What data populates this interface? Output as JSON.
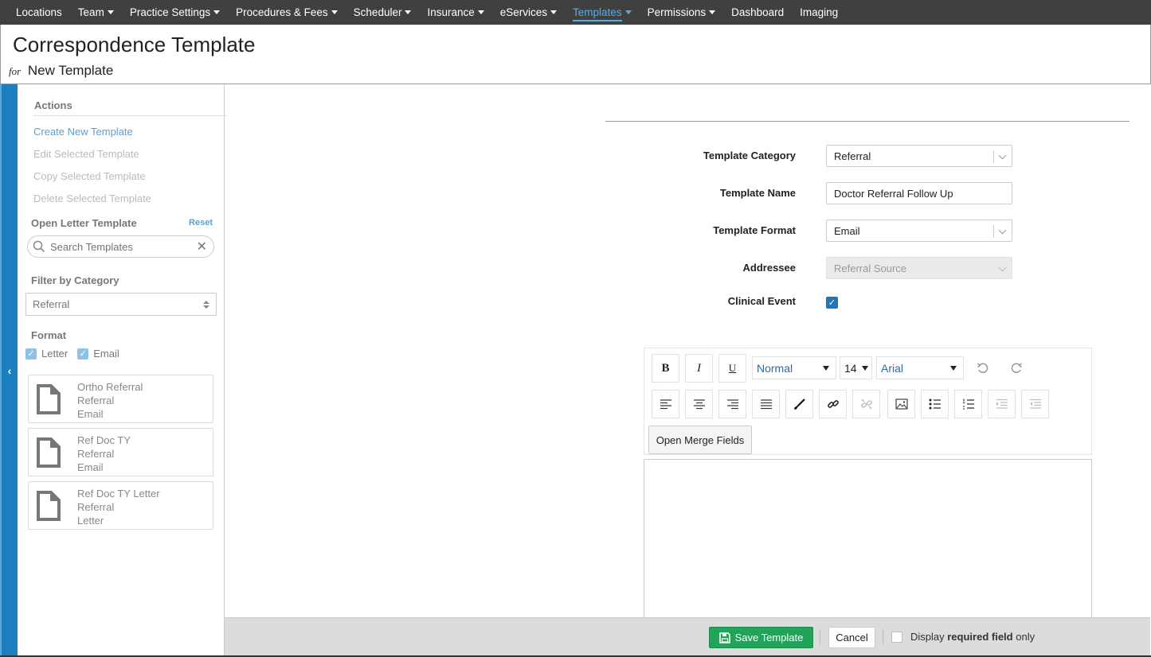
{
  "nav": {
    "items": [
      {
        "label": "Locations",
        "caret": false,
        "active": false
      },
      {
        "label": "Team",
        "caret": true,
        "active": false
      },
      {
        "label": "Practice Settings",
        "caret": true,
        "active": false
      },
      {
        "label": "Procedures & Fees",
        "caret": true,
        "active": false
      },
      {
        "label": "Scheduler",
        "caret": true,
        "active": false
      },
      {
        "label": "Insurance",
        "caret": true,
        "active": false
      },
      {
        "label": "eServices",
        "caret": true,
        "active": false
      },
      {
        "label": "Templates",
        "caret": true,
        "active": true
      },
      {
        "label": "Permissions",
        "caret": true,
        "active": false
      },
      {
        "label": "Dashboard",
        "caret": false,
        "active": false
      },
      {
        "label": "Imaging",
        "caret": false,
        "active": false
      }
    ]
  },
  "header": {
    "title": "Correspondence Template",
    "for_label": "for",
    "subtitle": "New Template"
  },
  "sidebar": {
    "actions_title": "Actions",
    "actions": [
      {
        "label": "Create New Template",
        "enabled": true
      },
      {
        "label": "Edit Selected Template",
        "enabled": false
      },
      {
        "label": "Copy Selected Template",
        "enabled": false
      },
      {
        "label": "Delete Selected Template",
        "enabled": false
      }
    ],
    "open_letter_title": "Open Letter Template",
    "reset_label": "Reset",
    "search_placeholder": "Search Templates",
    "filter_title": "Filter by Category",
    "filter_value": "Referral",
    "format_title": "Format",
    "format_letter": "Letter",
    "format_email": "Email",
    "templates": [
      {
        "name": "Ortho Referral",
        "category": "Referral",
        "format": "Email"
      },
      {
        "name": "Ref Doc TY",
        "category": "Referral",
        "format": "Email"
      },
      {
        "name": "Ref Doc TY Letter",
        "category": "Referral",
        "format": "Letter"
      }
    ]
  },
  "form": {
    "category_label": "Template Category",
    "category_value": "Referral",
    "name_label": "Template Name",
    "name_value": "Doctor Referral Follow Up",
    "format_label": "Template Format",
    "format_value": "Email",
    "addressee_label": "Addressee",
    "addressee_value": "Referral Source",
    "clinical_label": "Clinical Event",
    "clinical_checked": true
  },
  "editor": {
    "style_value": "Normal",
    "size_value": "14",
    "font_value": "Arial",
    "merge_label": "Open Merge Fields",
    "bold_label": "B",
    "italic_label": "I",
    "underline_label": "U"
  },
  "footer": {
    "save_label": "Save Template",
    "cancel_label": "Cancel",
    "display_label": "Display",
    "required_label": "required field",
    "only_label": "only"
  },
  "colors": {
    "nav_bg": "#404040",
    "accent": "#4fb0e8",
    "sidebar_bar": "#1e7fc0",
    "save_green": "#22a35a"
  }
}
